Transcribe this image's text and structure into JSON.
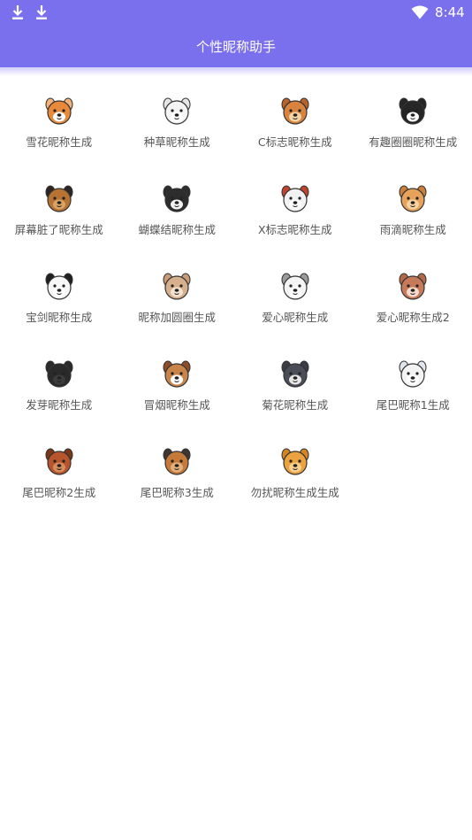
{
  "status_bar": {
    "time": "8:44",
    "icons": [
      "download-icon",
      "download-icon",
      "wifi-icon"
    ]
  },
  "app_bar": {
    "title": "个性昵称助手"
  },
  "colors": {
    "primary": "#7a70ee",
    "label": "#555555"
  },
  "items": [
    {
      "label": "雪花昵称生成",
      "icon": "shiba-dog-icon",
      "c": "#e9893a",
      "e": "#f3b27a",
      "f": "#ffffff"
    },
    {
      "label": "种草昵称生成",
      "icon": "pomeranian-dog-icon",
      "c": "#f4f4f4",
      "e": "#e6e6e6",
      "f": "#ffffff"
    },
    {
      "label": "C标志昵称生成",
      "icon": "chipmunk-icon",
      "c": "#d9833f",
      "e": "#b9622a",
      "f": "#f5d4a8"
    },
    {
      "label": "有趣圈圈昵称生成",
      "icon": "black-white-cat-icon",
      "c": "#262626",
      "e": "#262626",
      "f": "#ffffff"
    },
    {
      "label": "屏幕脏了昵称生成",
      "icon": "german-shepherd-icon",
      "c": "#b87333",
      "e": "#2f2623",
      "f": "#d8a364"
    },
    {
      "label": "蝴蝶结昵称生成",
      "icon": "husky-icon",
      "c": "#2d2d2d",
      "e": "#2d2d2d",
      "f": "#f2f2f2"
    },
    {
      "label": "X标志昵称生成",
      "icon": "beagle-icon",
      "c": "#f2f2f2",
      "e": "#c0432b",
      "f": "#ffffff"
    },
    {
      "label": "雨滴昵称生成",
      "icon": "bear-icon",
      "c": "#e7a35a",
      "e": "#c97f3a",
      "f": "#f6d2a2"
    },
    {
      "label": "宝剑昵称生成",
      "icon": "panda-icon",
      "c": "#f7f7f7",
      "e": "#1f1f1f",
      "f": "#ffffff"
    },
    {
      "label": "昵称加圆圈生成",
      "icon": "rabbit-icon",
      "c": "#d7b08d",
      "e": "#c99b76",
      "f": "#f4e3d0"
    },
    {
      "label": "爱心昵称生成",
      "icon": "dalmatian-icon",
      "c": "#f4f4f4",
      "e": "#9a9a9a",
      "f": "#ffffff"
    },
    {
      "label": "爱心昵称生成2",
      "icon": "pink-cat-icon",
      "c": "#c77a59",
      "e": "#b4684a",
      "f": "#f7dccd"
    },
    {
      "label": "发芽昵称生成",
      "icon": "black-cat-icon",
      "c": "#2a2a2a",
      "e": "#2a2a2a",
      "f": "#3c3c3c"
    },
    {
      "label": "冒烟昵称生成",
      "icon": "basset-hound-icon",
      "c": "#c9844a",
      "e": "#8d4e2b",
      "f": "#ffffff"
    },
    {
      "label": "菊花昵称生成",
      "icon": "schnauzer-icon",
      "c": "#4a4d57",
      "e": "#3a3d45",
      "f": "#e6e6e6"
    },
    {
      "label": "尾巴昵称1生成",
      "icon": "poodle-icon",
      "c": "#f3f3f3",
      "e": "#e0e6ee",
      "f": "#ffffff"
    },
    {
      "label": "尾巴昵称2生成",
      "icon": "mastiff-icon",
      "c": "#b8552c",
      "e": "#7c3517",
      "f": "#d88b5f"
    },
    {
      "label": "尾巴昵称3生成",
      "icon": "yorkie-icon",
      "c": "#c57a3a",
      "e": "#3d3530",
      "f": "#e4b07b"
    },
    {
      "label": "勿扰昵称生成生成",
      "icon": "golden-retriever-icon",
      "c": "#eba23f",
      "e": "#d48522",
      "f": "#f8d08f"
    }
  ]
}
